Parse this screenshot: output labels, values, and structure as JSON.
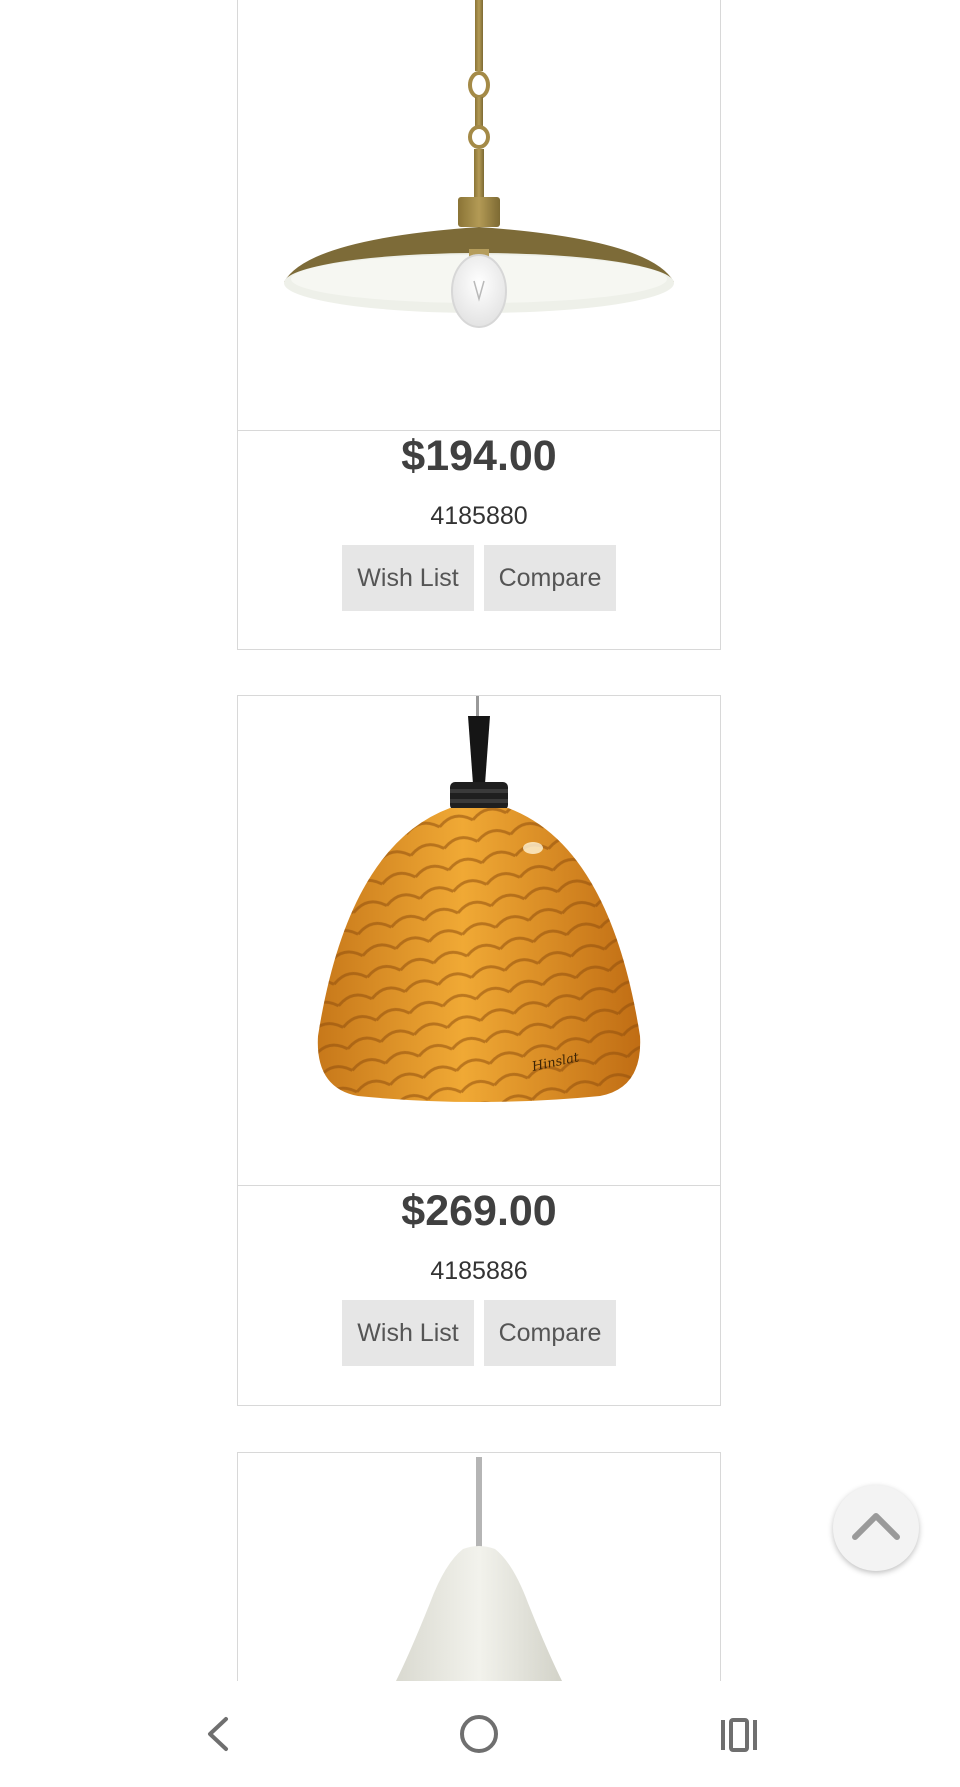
{
  "products": [
    {
      "price": "$194.00",
      "sku": "4185880",
      "wish_label": "Wish List",
      "compare_label": "Compare"
    },
    {
      "price": "$269.00",
      "sku": "4185886",
      "wish_label": "Wish List",
      "compare_label": "Compare"
    },
    {
      "price": "",
      "sku": ""
    }
  ],
  "icons": {
    "scroll_top": "chevron-up-icon",
    "nav_back": "back-icon",
    "nav_home": "home-icon",
    "nav_recents": "recents-icon"
  },
  "colors": {
    "button_bg": "#e6e6e6",
    "border": "#d8d8d8",
    "price": "#404040"
  }
}
